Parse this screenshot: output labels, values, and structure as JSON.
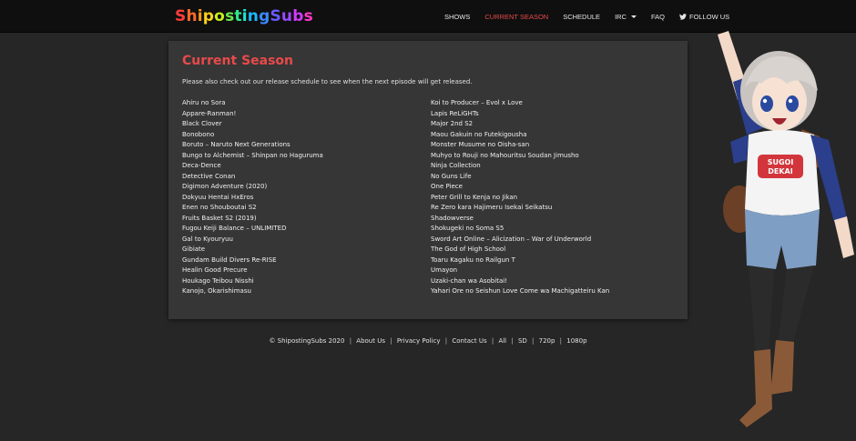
{
  "site": {
    "logo_letters": [
      "S",
      "h",
      "i",
      "p",
      "o",
      "s",
      "t",
      "i",
      "n",
      "g",
      "S",
      "u",
      "b",
      "s"
    ],
    "logo_colors": [
      "#ff3b3b",
      "#ff6a2a",
      "#ff9a1a",
      "#ffd21a",
      "#c8f01a",
      "#6ae84a",
      "#2ee890",
      "#1ae8d0",
      "#1ab8ff",
      "#3a8aff",
      "#6a5aff",
      "#9a4aff",
      "#d03aff",
      "#ff3ac8"
    ]
  },
  "nav": {
    "shows": "SHOWS",
    "current_season": "CURRENT SEASON",
    "schedule": "SCHEDULE",
    "irc": "IRC",
    "faq": "FAQ",
    "follow_us": "FOLLOW US"
  },
  "main": {
    "title": "Current Season",
    "intro": "Please also check out our release schedule to see when the next episode will get released.",
    "left_shows": [
      "Ahiru no Sora",
      "Appare-Ranman!",
      "Black Clover",
      "Bonobono",
      "Boruto – Naruto Next Generations",
      "Bungo to Alchemist – Shinpan no Haguruma",
      "Deca-Dence",
      "Detective Conan",
      "Digimon Adventure (2020)",
      "Dokyuu Hentai HxEros",
      "Enen no Shouboutai S2",
      "Fruits Basket S2 (2019)",
      "Fugou Keiji Balance – UNLIMITED",
      "Gal to Kyouryuu",
      "Gibiate",
      "Gundam Build Divers Re-RISE",
      "Healin Good Precure",
      "Houkago Teibou Nisshi",
      "Kanojo, Okarishimasu"
    ],
    "right_shows": [
      "Koi to Producer – Evol x Love",
      "Lapis ReLiGHTs",
      "Major 2nd S2",
      "Maou Gakuin no Futekigousha",
      "Monster Musume no Oisha-san",
      "Muhyo to Rouji no Mahouritsu Soudan Jimusho",
      "Ninja Collection",
      "No Guns Life",
      "One Piece",
      "Peter Grill to Kenja no Jikan",
      "Re Zero kara Hajimeru Isekai Seikatsu",
      "Shadowverse",
      "Shokugeki no Soma S5",
      "Sword Art Online – Alicization – War of Underworld",
      "The God of High School",
      "Toaru Kagaku no Railgun T",
      "Umayon",
      "Uzaki-chan wa Asobitai!",
      "Yahari Ore no Seishun Love Come wa Machigatteiru Kan"
    ]
  },
  "footer": {
    "copyright": "© ShipostingSubs 2020",
    "about": "About Us",
    "privacy": "Privacy Policy",
    "contact": "Contact Us",
    "all": "All",
    "sd": "SD",
    "p720": "720p",
    "p1080": "1080p",
    "separator": "|"
  },
  "mascot": {
    "shirt_text_line1": "SUGOI",
    "shirt_text_line2": "DEKAI"
  }
}
